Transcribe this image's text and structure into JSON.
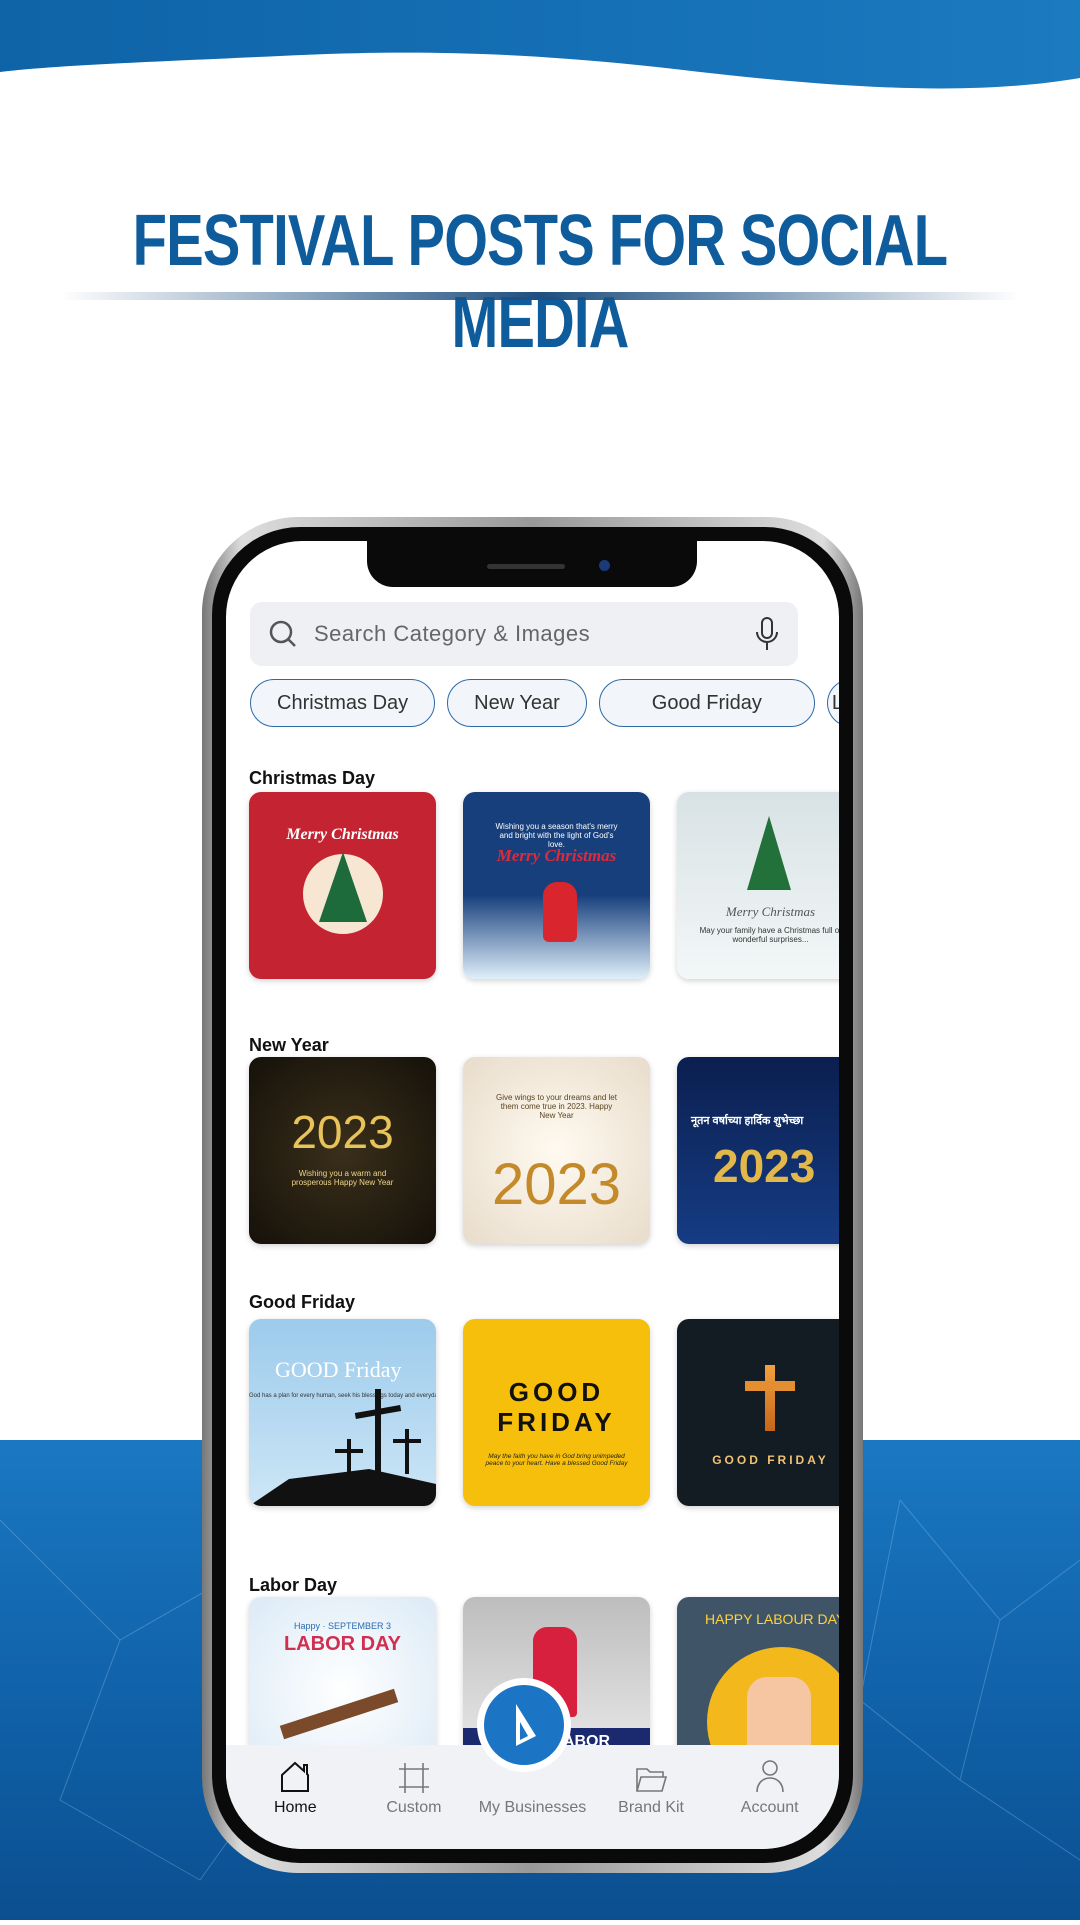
{
  "headline": "FESTIVAL POSTS FOR SOCIAL MEDIA",
  "colors": {
    "brand": "#1b74c4",
    "headline": "#0e5c9c",
    "background_blue": "#1670bb"
  },
  "search": {
    "placeholder": "Search Category & Images",
    "icon": "search-icon",
    "mic_icon": "microphone-icon"
  },
  "chips": [
    "Christmas Day",
    "New Year",
    "Good Friday",
    "L"
  ],
  "sections": [
    {
      "title": "Christmas Day",
      "thumbs": [
        {
          "title": "Merry Christmas",
          "sub": ""
        },
        {
          "title": "Merry Christmas",
          "sub": "Wishing you a season that's merry and bright with the light of God's love."
        },
        {
          "title": "Merry Christmas",
          "sub": "May your family have a Christmas full of wonderful surprises..."
        }
      ]
    },
    {
      "title": "New Year",
      "thumbs": [
        {
          "title": "2023",
          "sub": "Wishing you a warm and prosperous Happy New Year"
        },
        {
          "title": "2023",
          "sub": "Give wings to your dreams and let them come true in 2023. Happy New Year"
        },
        {
          "title": "2023",
          "sub": "नूतन वर्षाच्या हार्दिक शुभेच्छा"
        }
      ]
    },
    {
      "title": "Good Friday",
      "thumbs": [
        {
          "title": "GOOD Friday",
          "sub": "God has a plan for every human, seek his blessings today and everyday."
        },
        {
          "title": "GOOD FRIDAY",
          "sub": "May the faith you have in God bring unimpeded peace to your heart. Have a blessed Good Friday"
        },
        {
          "title": "GOOD FRIDAY",
          "sub": ""
        }
      ]
    },
    {
      "title": "Labor Day",
      "thumbs": [
        {
          "title": "LABOR DAY",
          "sub": "Happy · SEPTEMBER 3"
        },
        {
          "title": "LABOR",
          "sub": ""
        },
        {
          "title": "HAPPY LABOUR DAY",
          "sub": ""
        }
      ]
    }
  ],
  "nav": [
    {
      "label": "Home",
      "icon": "home-icon",
      "active": true
    },
    {
      "label": "Custom",
      "icon": "crop-icon"
    },
    {
      "label": "My Businesses",
      "icon": "logo-icon"
    },
    {
      "label": "Brand Kit",
      "icon": "folder-icon"
    },
    {
      "label": "Account",
      "icon": "user-icon"
    }
  ]
}
